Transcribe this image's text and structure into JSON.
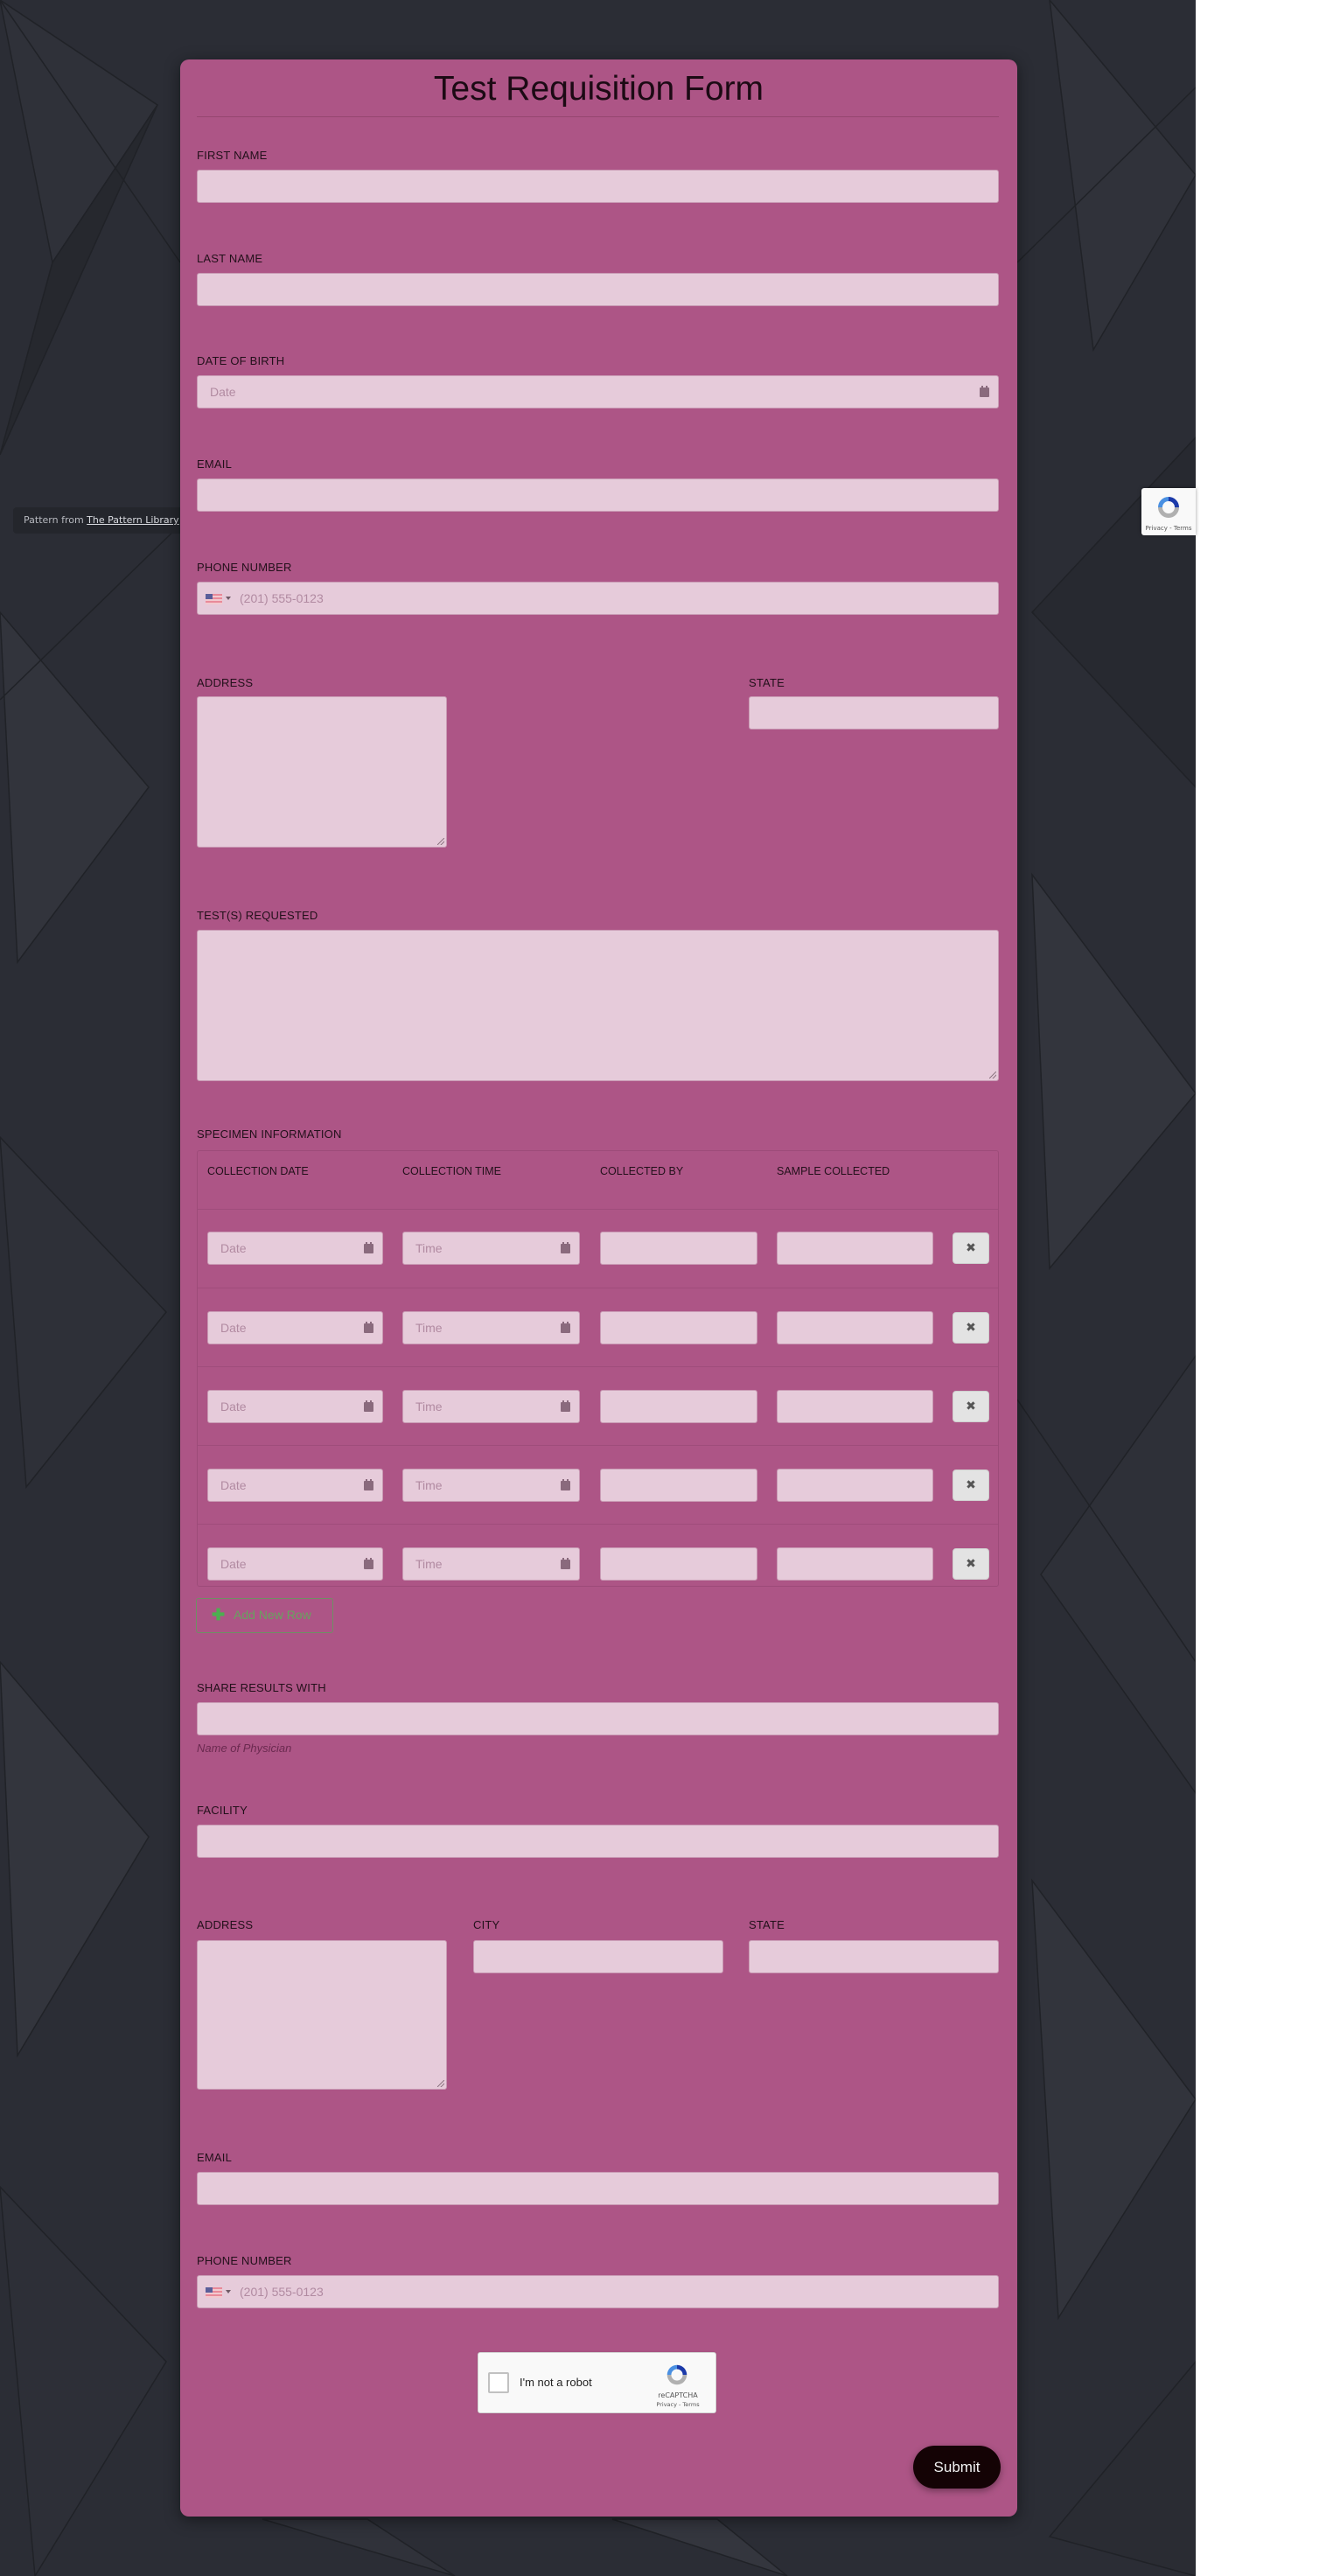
{
  "form": {
    "title": "Test Requisition Form",
    "fields": {
      "first_name": {
        "label": "FIRST NAME",
        "value": ""
      },
      "last_name": {
        "label": "LAST NAME",
        "value": ""
      },
      "date_of_birth": {
        "label": "DATE OF BIRTH",
        "placeholder": "Date",
        "icon": "calendar-icon"
      },
      "email": {
        "label": "EMAIL",
        "value": ""
      },
      "phone": {
        "label": "PHONE NUMBER",
        "placeholder": "(201) 555-0123",
        "country": "US",
        "icon": "us-flag-icon"
      },
      "address": {
        "label": "ADDRESS",
        "value": ""
      },
      "state": {
        "label": "STATE",
        "value": ""
      },
      "tests_requested": {
        "label": "TEST(S) REQUESTED",
        "value": ""
      }
    },
    "specimen": {
      "label": "SPECIMEN INFORMATION",
      "columns": [
        "COLLECTION DATE",
        "COLLECTION TIME",
        "COLLECTED BY",
        "SAMPLE COLLECTED"
      ],
      "rows": [
        {
          "date_placeholder": "Date",
          "time_placeholder": "Time",
          "collected_by": "",
          "sample_collected": ""
        },
        {
          "date_placeholder": "Date",
          "time_placeholder": "Time",
          "collected_by": "",
          "sample_collected": ""
        },
        {
          "date_placeholder": "Date",
          "time_placeholder": "Time",
          "collected_by": "",
          "sample_collected": ""
        },
        {
          "date_placeholder": "Date",
          "time_placeholder": "Time",
          "collected_by": "",
          "sample_collected": ""
        },
        {
          "date_placeholder": "Date",
          "time_placeholder": "Time",
          "collected_by": "",
          "sample_collected": ""
        }
      ],
      "remove_label": "✖",
      "add_row_label": "Add New Row",
      "add_row_icon": "plus-icon"
    },
    "share_results": {
      "label": "SHARE RESULTS WITH",
      "value": "",
      "helper": "Name of Physician"
    },
    "facility": {
      "label": "FACILITY",
      "value": ""
    },
    "facility_address": {
      "label": "ADDRESS",
      "value": ""
    },
    "facility_city": {
      "label": "CITY",
      "value": ""
    },
    "facility_state": {
      "label": "STATE",
      "value": ""
    },
    "facility_email": {
      "label": "EMAIL",
      "value": ""
    },
    "facility_phone": {
      "label": "PHONE NUMBER",
      "placeholder": "(201) 555-0123",
      "country": "US"
    },
    "captcha": {
      "label": "I'm not a robot",
      "brand": "reCAPTCHA",
      "links": "Privacy - Terms"
    },
    "submit_label": "Submit"
  },
  "credit": {
    "prefix": "Pattern from ",
    "link": "The Pattern Library"
  },
  "recaptcha_badge": {
    "links": "Privacy - Terms"
  },
  "colors": {
    "card": "#ad5586",
    "input": "#e6cbda",
    "page_bg": "#2b2d35",
    "submit": "#140305",
    "add_row": "#67a35f"
  }
}
